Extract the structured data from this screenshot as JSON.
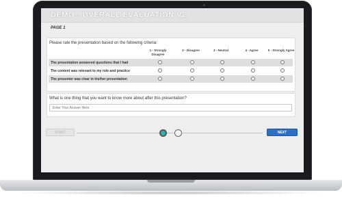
{
  "survey": {
    "title": "DEMO - OVERALL EVALUATION V2",
    "page_label": "PAGE 1"
  },
  "rating_question": {
    "prompt": "Please rate the presentation based on the following criteria:",
    "scale": [
      "1 - Strongly Disagree",
      "2 - Disagree",
      "3 - Neutral",
      "4 - Agree",
      "5 - Strongly Agree"
    ],
    "statements": [
      "The presentation answered questions that I had",
      "The content was relevant to my role and practice",
      "The presenter was clear in his/her presentation"
    ]
  },
  "open_question": {
    "prompt": "What is one thing that you want to know more about after this presentation?",
    "placeholder": "Enter Your Answer Here"
  },
  "navigation": {
    "start_label": "START",
    "next_label": "NEXT",
    "current_page": 1,
    "total_pages": 2
  },
  "colors": {
    "accent": "#2ab7b3",
    "next_button": "#2f6fc4"
  }
}
